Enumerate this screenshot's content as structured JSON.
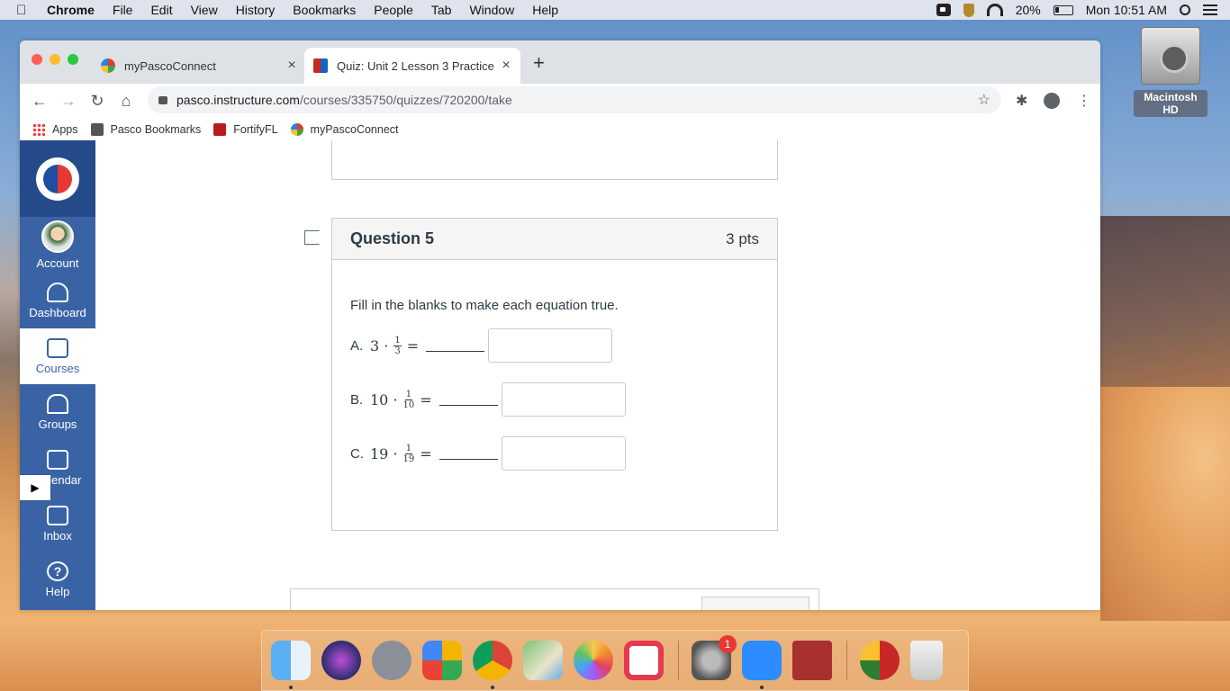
{
  "menubar": {
    "app_name": "Chrome",
    "items": [
      "File",
      "Edit",
      "View",
      "History",
      "Bookmarks",
      "People",
      "Tab",
      "Window",
      "Help"
    ],
    "battery": "20%",
    "clock": "Mon 10:51 AM"
  },
  "desktop": {
    "drive_label": "Macintosh HD"
  },
  "browser": {
    "tabs": [
      {
        "title": "myPascoConnect",
        "active": false
      },
      {
        "title": "Quiz: Unit 2 Lesson 3 Practice",
        "active": true
      }
    ],
    "url_host": "pasco.instructure.com",
    "url_path": "/courses/335750/quizzes/720200/take",
    "bookmarks": [
      "Apps",
      "Pasco Bookmarks",
      "FortifyFL",
      "myPascoConnect"
    ]
  },
  "canvas_nav": {
    "items": [
      {
        "label": "Account",
        "icon": "avatar"
      },
      {
        "label": "Dashboard",
        "icon": "dashboard-icon"
      },
      {
        "label": "Courses",
        "icon": "courses-icon",
        "selected": true
      },
      {
        "label": "Groups",
        "icon": "groups-icon"
      },
      {
        "label": "Calendar",
        "icon": "calendar-icon"
      },
      {
        "label": "Inbox",
        "icon": "inbox-icon"
      },
      {
        "label": "Help",
        "icon": "help-icon"
      }
    ]
  },
  "question": {
    "title": "Question 5",
    "points": "3 pts",
    "prompt": "Fill in the blanks to make each equation true.",
    "rows": [
      {
        "label": "A.",
        "whole": "3",
        "num": "1",
        "den": "3",
        "answer": ""
      },
      {
        "label": "B.",
        "whole": "10",
        "num": "1",
        "den": "10",
        "answer": ""
      },
      {
        "label": "C.",
        "whole": "19",
        "num": "1",
        "den": "19",
        "answer": ""
      }
    ]
  },
  "dock": {
    "apps": [
      "finder-icon",
      "siri-icon",
      "launchpad-icon",
      "app-store-icon",
      "chrome-icon",
      "maps-icon",
      "photos-icon",
      "news-icon",
      "system-preferences-icon",
      "zoom-icon",
      "dictionary-icon",
      "mypascoconnect-icon",
      "trash-icon"
    ],
    "system_preferences_badge": "1"
  },
  "colors": {
    "canvas_nav": "#3a63a6",
    "canvas_nav_dark": "#254a8a",
    "text": "#2d3b45"
  }
}
